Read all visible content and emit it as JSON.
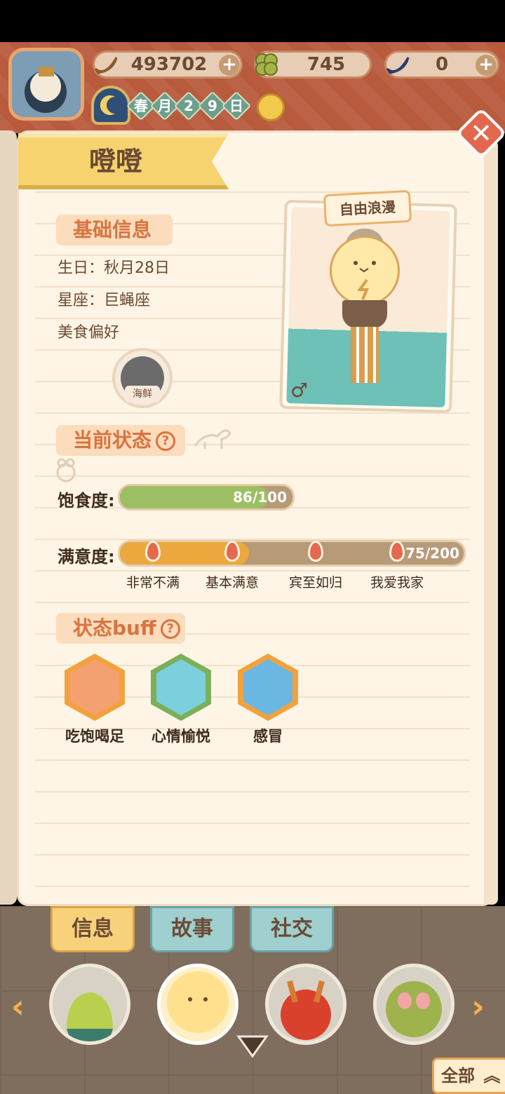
{
  "hud": {
    "bananas": "493702",
    "clovers": "745",
    "blue_bananas": "0",
    "date_chars": [
      "春",
      "月",
      "2",
      "9",
      "日"
    ]
  },
  "character": {
    "name": "噔噔",
    "card_tag": "自由浪漫",
    "gender_symbol": "♂"
  },
  "basic_info": {
    "title": "基础信息",
    "birthday": "生日：秋月28日",
    "zodiac": "星座：巨蝇座",
    "food_pref_label": "美食偏好",
    "food_pref": "海鲜"
  },
  "status": {
    "title": "当前状态",
    "help": "?",
    "satiety_label": "饱食度:",
    "satiety_value": "86/100",
    "satiety_fraction": 0.86,
    "satisfaction_label": "满意度:",
    "satisfaction_value": "75/200",
    "satisfaction_fraction": 0.375,
    "milestones": [
      "非常不满",
      "基本满意",
      "宾至如归",
      "我爱我家"
    ]
  },
  "buffs": {
    "title": "状态buff",
    "help": "?",
    "items": [
      {
        "label": "吃饱喝足",
        "color": "#f4a070"
      },
      {
        "label": "心情愉悦",
        "color": "#7ccfdc"
      },
      {
        "label": "感冒",
        "color": "#6ab7e4"
      }
    ]
  },
  "tabs": [
    "信息",
    "故事",
    "社交"
  ],
  "all_button": "全部",
  "colors": {
    "accent": "#d9733f",
    "satiety_bar": "#9cbf63",
    "satisfaction_bar": "#eca83e"
  }
}
